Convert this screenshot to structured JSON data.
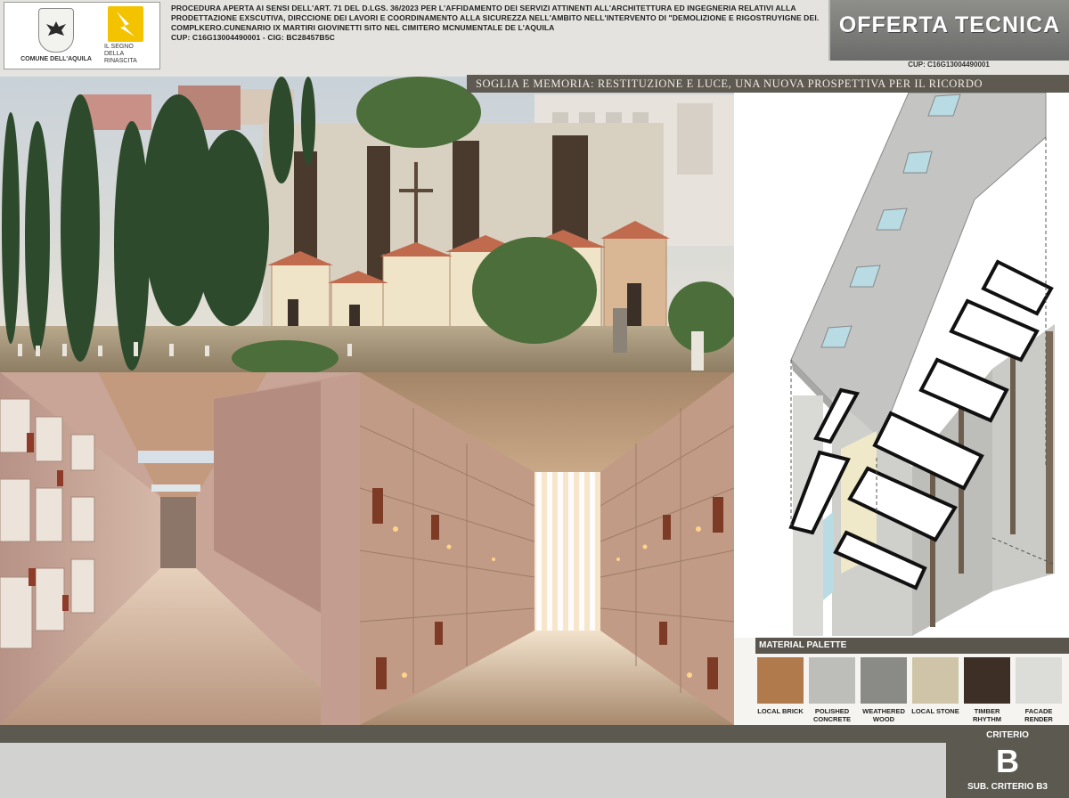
{
  "header": {
    "comune_name": "COMUNE DELL'AQUILA",
    "rinascita_name": "IL SEGNO DELLA RINASCITA",
    "procedure_text": "PROCEDURA APERTA AI SENSI DELL'ART. 71 DEL D.LGS. 36/2023 PER L'AFFIDAMENTO DEI SERVIZI ATTINENTI ALL'ARCHITETTURA ED INGEGNERIA RELATIVI ALLA PRODETTAZIONE EXSCUTIVA, DIRCCIONE DEI LAVORI E COORDINAMENTO ALLA SICUREZZA NELL'AMBITO NELL'INTERVENTO DI \"DEMOLIZIONE E RIGOSTRUYIGNE DEI. COMPLKERO.CUNENARIO IX MARTIRI GIOVINETTI SITO NEL CIMITERO MCNUMENTALE DE L'AQUILA",
    "codes_text": "CUP: C16G13004490001 - CIG: BC28457B5C",
    "title": "OFFERTA TECNICA",
    "cup": "CUP: C16G13004490001"
  },
  "banner": {
    "text": "SOGLIA E MEMORIA: RESTITUZIONE E LUCE, UNA NUOVA PROSPETTIVA PER IL RICORDO"
  },
  "palette": {
    "title": "MATERIAL PALETTE",
    "items": [
      {
        "label": "LOCAL BRICK",
        "color": "#b07a4c"
      },
      {
        "label": "POLISHED CONCRETE",
        "color": "#bdbdba"
      },
      {
        "label": "WEATHERED WOOD",
        "color": "#8a8a86"
      },
      {
        "label": "LOCAL STONE",
        "color": "#cfc4a8"
      },
      {
        "label": "TIMBER RHYTHM",
        "color": "#3d2f26"
      },
      {
        "label": "FACADE RENDER",
        "color": "#dcdcd8"
      }
    ]
  },
  "criterio": {
    "label": "CRITERIO",
    "letter": "B",
    "sub_label": "SUB. CRITERIO B3"
  }
}
